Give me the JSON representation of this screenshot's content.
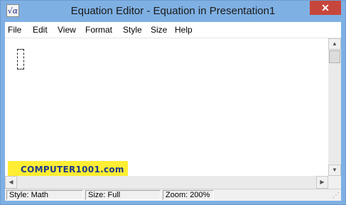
{
  "window": {
    "title": "Equation Editor - Equation in Presentation1",
    "icon": "equation-editor-icon",
    "close_glyph": "✕"
  },
  "menu": {
    "items": [
      "File",
      "Edit",
      "View",
      "Format",
      "Style",
      "Size",
      "Help"
    ]
  },
  "watermark": {
    "text": "COMPUTER1001.com"
  },
  "status": {
    "style": "Style: Math",
    "size": "Size: Full",
    "zoom": "Zoom: 200%"
  },
  "colors": {
    "titlebar": "#7fb0e3",
    "close_button": "#c7463b",
    "watermark_bg": "#ffee33",
    "watermark_text": "#1e3a8a"
  }
}
